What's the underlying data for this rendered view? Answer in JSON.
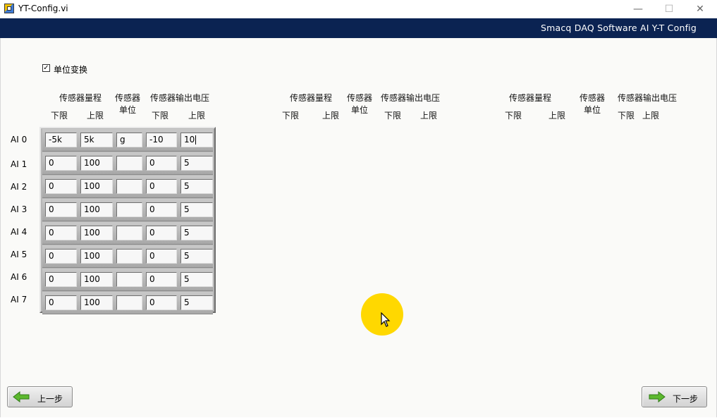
{
  "window": {
    "title": "YT-Config.vi",
    "minimize": "—",
    "maximize": "☐",
    "close": "✕"
  },
  "banner": {
    "text": "Smacq DAQ Software AI Y-T Config"
  },
  "unit_toggle": {
    "label": "单位变换",
    "checked": true,
    "mark": "✓"
  },
  "headers": {
    "range": "传感器量程",
    "unit_l1": "传感器",
    "unit_l2": "单位",
    "voltage": "传感器输出电压",
    "lower": "下限",
    "upper": "上限"
  },
  "rows": [
    {
      "label": "AI 0",
      "range_lower": "-5k",
      "range_upper": "5k",
      "unit": "g",
      "volt_lower": "-10",
      "volt_upper": "10"
    },
    {
      "label": "AI 1",
      "range_lower": "0",
      "range_upper": "100",
      "unit": "",
      "volt_lower": "0",
      "volt_upper": "5"
    },
    {
      "label": "AI 2",
      "range_lower": "0",
      "range_upper": "100",
      "unit": "",
      "volt_lower": "0",
      "volt_upper": "5"
    },
    {
      "label": "AI 3",
      "range_lower": "0",
      "range_upper": "100",
      "unit": "",
      "volt_lower": "0",
      "volt_upper": "5"
    },
    {
      "label": "AI 4",
      "range_lower": "0",
      "range_upper": "100",
      "unit": "",
      "volt_lower": "0",
      "volt_upper": "5"
    },
    {
      "label": "AI 5",
      "range_lower": "0",
      "range_upper": "100",
      "unit": "",
      "volt_lower": "0",
      "volt_upper": "5"
    },
    {
      "label": "AI 6",
      "range_lower": "0",
      "range_upper": "100",
      "unit": "",
      "volt_lower": "0",
      "volt_upper": "5"
    },
    {
      "label": "AI 7",
      "range_lower": "0",
      "range_upper": "100",
      "unit": "",
      "volt_lower": "0",
      "volt_upper": "5"
    }
  ],
  "buttons": {
    "prev": "上一步",
    "next": "下一步"
  },
  "colors": {
    "banner": "#0b2352",
    "arrow": "#5cb82e",
    "highlight": "#ffd800"
  },
  "icons": {
    "arrow_left": "left-arrow-icon",
    "arrow_right": "right-arrow-icon",
    "cursor": "mouse-cursor-icon"
  }
}
